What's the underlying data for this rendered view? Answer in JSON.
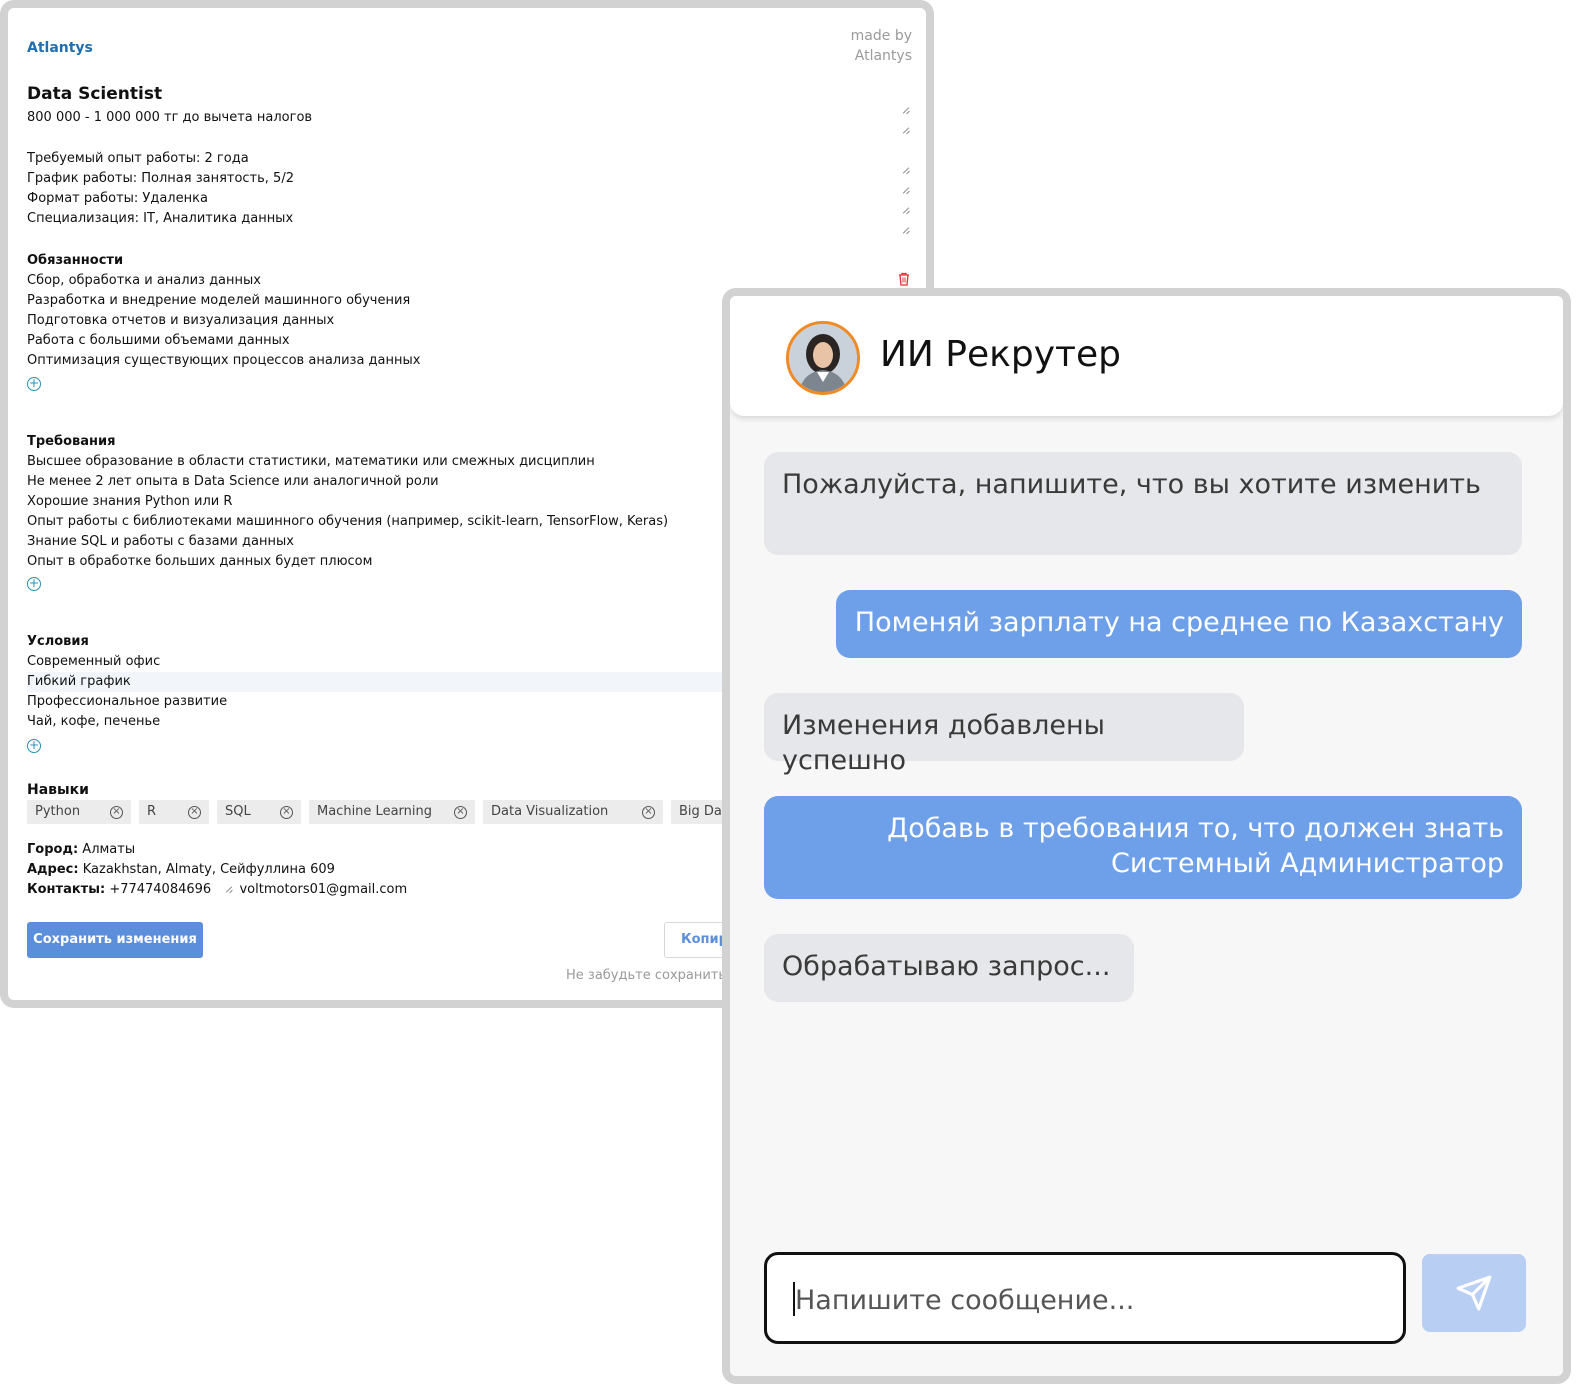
{
  "editor": {
    "brand": "Atlantys",
    "made_by_line1": "made by",
    "made_by_line2": "Atlantys",
    "title": "Data Scientist",
    "salary": "800 000 - 1 000 000 тг до вычета налогов",
    "info": [
      "Требуемый опыт работы: 2 года",
      "График работы: Полная занятость, 5/2",
      "Формат работы: Удаленка",
      "Специализация: IT, Аналитика данных"
    ],
    "duties_title": "Обязанности",
    "duties": [
      "Сбор, обработка и анализ данных",
      "Разработка и внедрение моделей машинного обучения",
      "Подготовка отчетов и визуализация данных",
      "Работа с большими объемами данных",
      "Оптимизация существующих процессов анализа данных"
    ],
    "requirements_title": "Требования",
    "requirements": [
      "Высшее образование в области статистики, математики или смежных дисциплин",
      "Не менее 2 лет опыта в Data Science или аналогичной роли",
      "Хорошие знания Python или R",
      "Опыт работы с библиотеками машинного обучения (например, scikit-learn, TensorFlow, Keras)",
      "Знание SQL и работы с базами данных",
      "Опыт в обработке больших данных будет плюсом"
    ],
    "conditions_title": "Условия",
    "conditions": [
      "Современный офис",
      "Гибкий график",
      "Профессиональное развитие",
      "Чай, кофе, печенье"
    ],
    "skills_title": "Навыки",
    "skills": [
      "Python",
      "R",
      "SQL",
      "Machine Learning",
      "Data Visualization",
      "Big Data"
    ],
    "city_label": "Город:",
    "city": "Алматы",
    "address_label": "Адрес:",
    "address": "Kazakhstan, Almaty, Сейфуллина 609",
    "contacts_label": "Контакты:",
    "phone": "+77474084696",
    "email": "voltmotors01@gmail.com",
    "save_label": "Сохранить изменения",
    "copy_label": "Копировать",
    "hint": "Не забудьте сохранить изменения"
  },
  "chat": {
    "title": "ИИ Рекрутер",
    "messages": [
      {
        "role": "bot",
        "text": "Пожалуйста, напишите, что вы хотите изменить"
      },
      {
        "role": "user",
        "text": "Поменяй зарплату на среднее по Казахстану"
      },
      {
        "role": "bot",
        "text": "Изменения добавлены успешно"
      },
      {
        "role": "user",
        "text": "Добавь в требования то, что должен знать Системный Администратор"
      },
      {
        "role": "bot",
        "text": "Обрабатываю запрос..."
      }
    ],
    "input_placeholder": "Напишите сообщение...",
    "send_icon": "send-icon"
  },
  "colors": {
    "brand": "#1f6fb2",
    "primary_button": "#5b8fdc",
    "user_bubble": "#6e9fe9",
    "bot_bubble": "#e6e7ea",
    "avatar_ring": "#f08a24",
    "send_button": "#b8cef3"
  }
}
